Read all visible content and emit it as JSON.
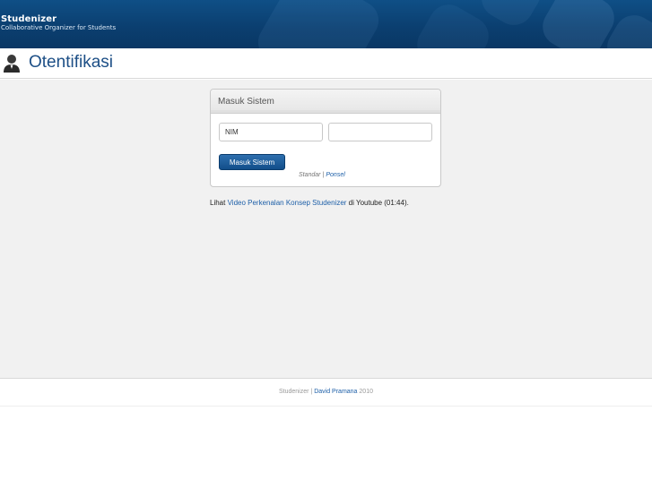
{
  "brand": {
    "name": "Studenizer",
    "tagline": "Collaborative Organizer for Students"
  },
  "page": {
    "title": "Otentifikasi",
    "title_icon": "user-icon"
  },
  "login": {
    "panel_title": "Masuk Sistem",
    "nim_value": "NIM",
    "password_value": "",
    "submit_label": "Masuk Sistem",
    "mode_standard": "Standar",
    "mode_separator": "|",
    "mode_mobile": "Ponsel"
  },
  "intro": {
    "prefix": "Lihat",
    "link_text": "Video Perkenalan Konsep Studenizer",
    "suffix": "di Youtube (01:44)."
  },
  "footer": {
    "app_name": "Studenizer",
    "separator": "|",
    "author": "David Pramana",
    "year": "2010"
  },
  "colors": {
    "header_bg": "#0b3f70",
    "link": "#1d5fa8",
    "title": "#1d4f86",
    "button": "#124e8a",
    "content_bg": "#f1f1f1"
  }
}
